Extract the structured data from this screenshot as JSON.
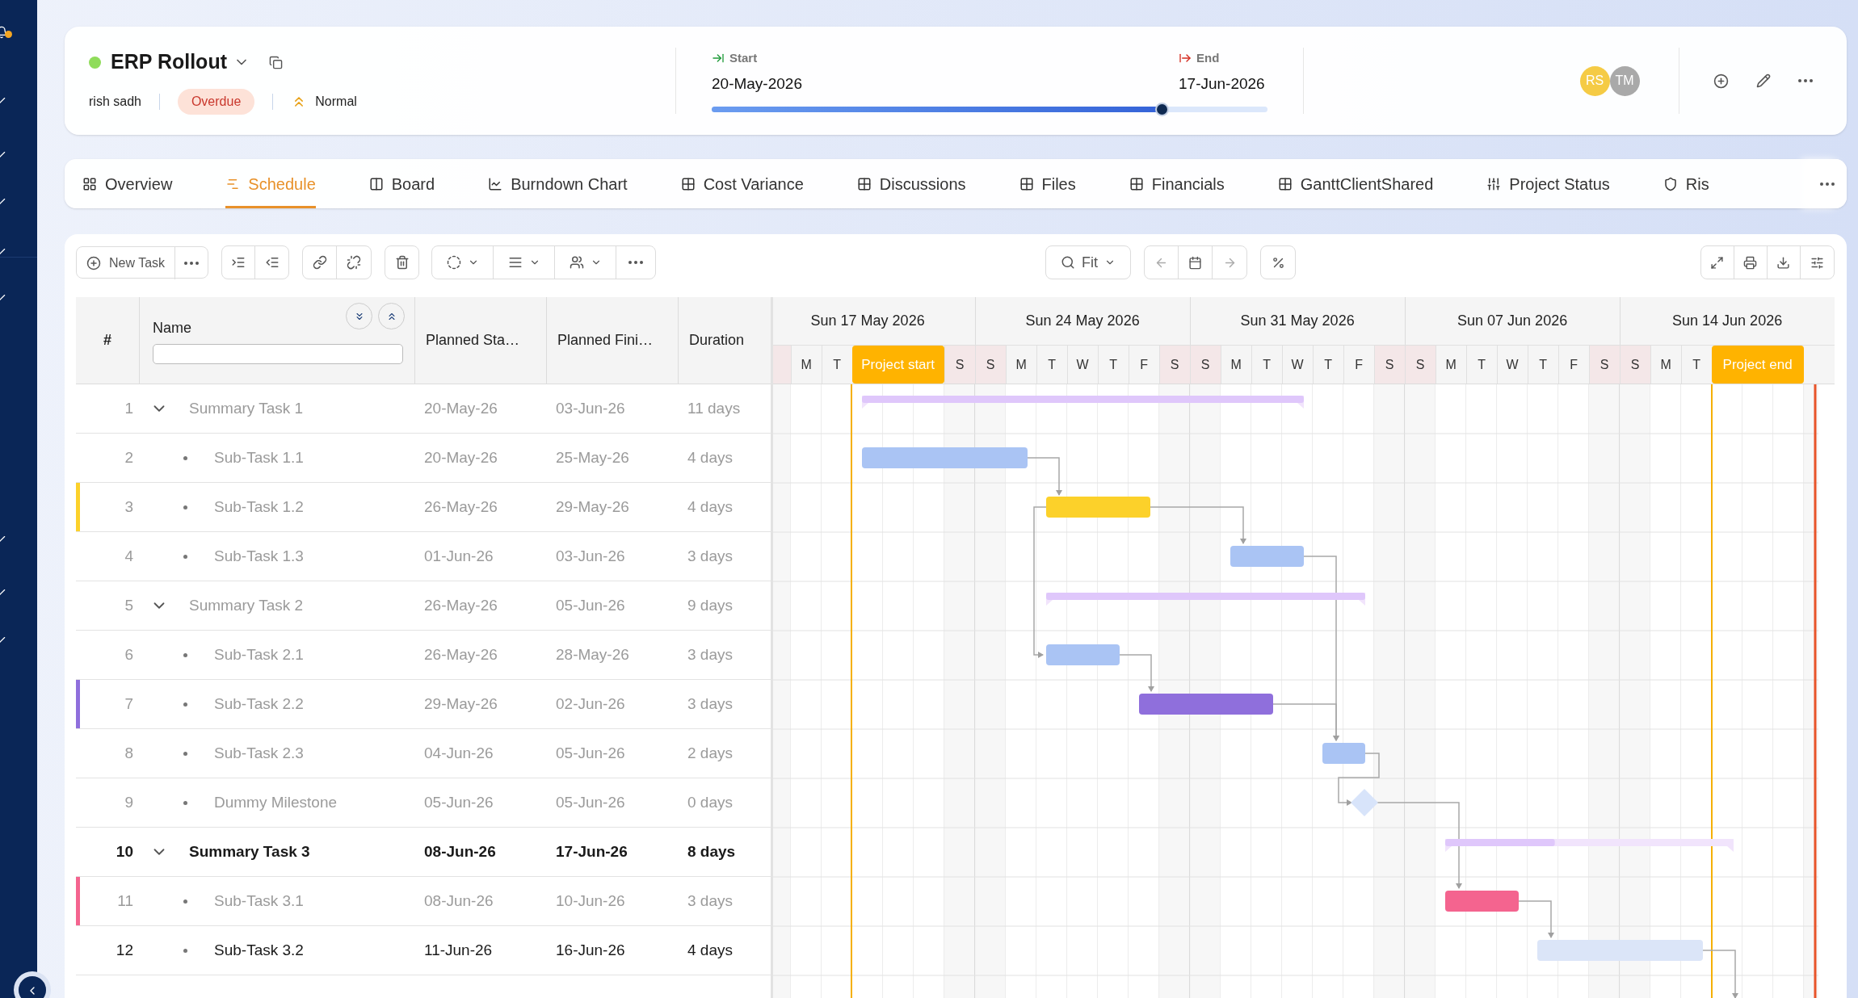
{
  "project": {
    "title": "ERP Rollout",
    "owner": "rish sadh",
    "status": "Overdue",
    "priority": "Normal",
    "start": {
      "label": "Start",
      "date": "20-May-2026"
    },
    "end": {
      "label": "End",
      "date": "17-Jun-2026"
    },
    "progress": {
      "level": 0.81
    },
    "members": [
      {
        "initials": "RS",
        "color": "#f5cb45"
      },
      {
        "initials": "TM",
        "color": "#a9a9a9"
      }
    ]
  },
  "tabs": [
    {
      "label": "Overview",
      "selected": false
    },
    {
      "label": "Schedule",
      "selected": true
    },
    {
      "label": "Board",
      "selected": false
    },
    {
      "label": "Burndown Chart",
      "selected": false
    },
    {
      "label": "Cost Variance",
      "selected": false
    },
    {
      "label": "Discussions",
      "selected": false
    },
    {
      "label": "Files",
      "selected": false
    },
    {
      "label": "Financials",
      "selected": false
    },
    {
      "label": "GanttClientShared",
      "selected": false
    },
    {
      "label": "Project Status",
      "selected": false
    },
    {
      "label": "Ris",
      "selected": false
    }
  ],
  "toolbar": {
    "new_task": "New Task",
    "zoom": "Fit"
  },
  "table": {
    "columns": [
      "#",
      "Name",
      "Planned Sta…",
      "Planned Fini…",
      "Duration"
    ],
    "rows": [
      {
        "num": "1",
        "name": "Summary Task 1",
        "start": "20-May-26",
        "finish": "03-Jun-26",
        "duration": "11 days",
        "kind": "summary",
        "expanded": true,
        "dimmed": true,
        "bold": false,
        "level": 1,
        "children": [
          {
            "num": "2",
            "name": "Sub-Task 1.1",
            "start": "20-May-26",
            "finish": "25-May-26",
            "duration": "4 days",
            "kind": "task",
            "dimmed": true,
            "bold": false
          },
          {
            "num": "3",
            "name": "Sub-Task 1.2",
            "start": "26-May-26",
            "finish": "29-May-26",
            "duration": "4 days",
            "kind": "task",
            "dimmed": true,
            "bold": false,
            "color": "#fcd12a"
          },
          {
            "num": "4",
            "name": "Sub-Task 1.3",
            "start": "01-Jun-26",
            "finish": "03-Jun-26",
            "duration": "3 days",
            "kind": "task",
            "dimmed": true,
            "bold": false
          }
        ]
      },
      {
        "num": "5",
        "name": "Summary Task 2",
        "start": "26-May-26",
        "finish": "05-Jun-26",
        "duration": "9 days",
        "kind": "summary",
        "expanded": true,
        "dimmed": true,
        "bold": false,
        "level": 1,
        "children": [
          {
            "num": "6",
            "name": "Sub-Task 2.1",
            "start": "26-May-26",
            "finish": "28-May-26",
            "duration": "3 days",
            "kind": "task",
            "dimmed": true,
            "bold": false
          },
          {
            "num": "7",
            "name": "Sub-Task 2.2",
            "start": "29-May-26",
            "finish": "02-Jun-26",
            "duration": "3 days",
            "kind": "task",
            "dimmed": true,
            "bold": false,
            "color": "#8f6fdc"
          },
          {
            "num": "8",
            "name": "Sub-Task 2.3",
            "start": "04-Jun-26",
            "finish": "05-Jun-26",
            "duration": "2 days",
            "kind": "task",
            "dimmed": true,
            "bold": false
          },
          {
            "num": "9",
            "name": "Dummy Milestone",
            "start": "05-Jun-26",
            "finish": "05-Jun-26",
            "duration": "0 days",
            "kind": "milestone",
            "dimmed": true,
            "bold": false
          }
        ]
      },
      {
        "num": "10",
        "name": "Summary Task 3",
        "start": "08-Jun-26",
        "finish": "17-Jun-26",
        "duration": "8 days",
        "kind": "summary",
        "expanded": true,
        "dimmed": false,
        "bold": true,
        "level": 0.38,
        "children": [
          {
            "num": "11",
            "name": "Sub-Task 3.1",
            "start": "08-Jun-26",
            "finish": "10-Jun-26",
            "duration": "3 days",
            "kind": "task",
            "dimmed": true,
            "bold": false,
            "color": "#f4648f"
          },
          {
            "num": "12",
            "name": "Sub-Task 3.2",
            "start": "11-Jun-26",
            "finish": "16-Jun-26",
            "duration": "4 days",
            "kind": "task",
            "dimmed": false,
            "bold": false
          }
        ]
      }
    ]
  },
  "timeline": {
    "weeks": [
      "Sun 17 May 2026",
      "Sun 24 May 2026",
      "Sun 31 May 2026",
      "Sun 07 Jun 2026",
      "Sun 14 Jun 2026"
    ],
    "days": [
      {
        "kind": "day"
      },
      {
        "kind": "day",
        "label": "M"
      },
      {
        "kind": "day",
        "label": "T"
      },
      {
        "kind": "marker",
        "label": "Project start"
      },
      {
        "kind": "day",
        "label": "S"
      },
      {
        "kind": "day",
        "label": "S"
      },
      {
        "kind": "day",
        "label": "M"
      },
      {
        "kind": "day",
        "label": "T"
      },
      {
        "kind": "day",
        "label": "W"
      },
      {
        "kind": "day",
        "label": "T"
      },
      {
        "kind": "day",
        "label": "F"
      },
      {
        "kind": "day",
        "label": "S"
      },
      {
        "kind": "day",
        "label": "S"
      },
      {
        "kind": "day",
        "label": "M"
      },
      {
        "kind": "day",
        "label": "T"
      },
      {
        "kind": "day",
        "label": "W"
      },
      {
        "kind": "day",
        "label": "T"
      },
      {
        "kind": "day",
        "label": "F"
      },
      {
        "kind": "day",
        "label": "S"
      },
      {
        "kind": "day",
        "label": "S"
      },
      {
        "kind": "day",
        "label": "M"
      },
      {
        "kind": "day",
        "label": "T"
      },
      {
        "kind": "day",
        "label": "W"
      },
      {
        "kind": "day",
        "label": "T"
      },
      {
        "kind": "day",
        "label": "F"
      },
      {
        "kind": "day",
        "label": "S"
      },
      {
        "kind": "day",
        "label": "S"
      },
      {
        "kind": "day",
        "label": "M"
      },
      {
        "kind": "day",
        "label": "T"
      },
      {
        "kind": "marker",
        "label": "Project end"
      }
    ]
  }
}
